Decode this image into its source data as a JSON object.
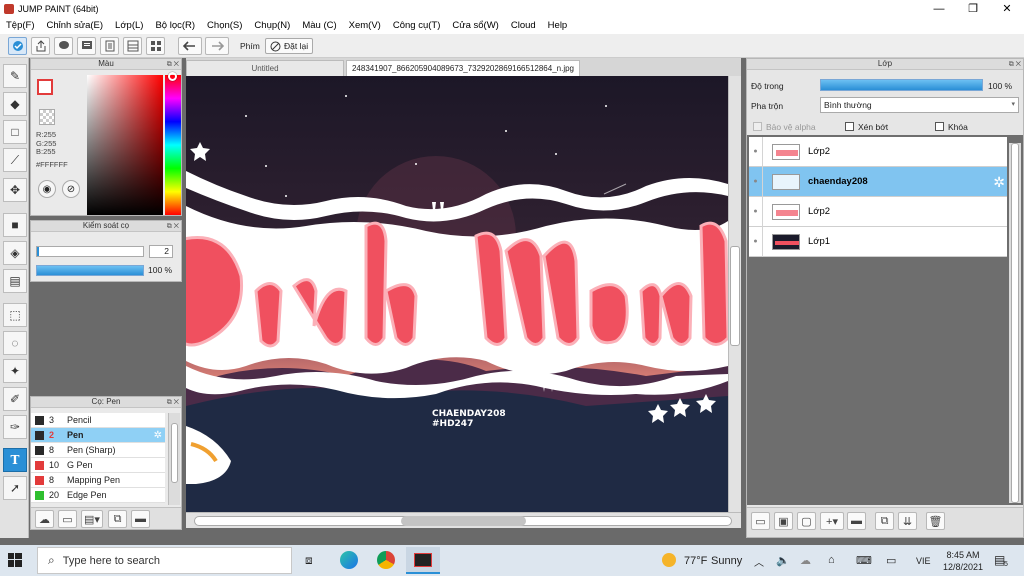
{
  "app": {
    "title": "JUMP PAINT (64bit)",
    "window_buttons": [
      "—",
      "❐",
      "✕"
    ]
  },
  "menu": [
    "Tệp(F)",
    "Chỉnh sửa(E)",
    "Lớp(L)",
    "Bộ lọc(R)",
    "Chọn(S)",
    "Chụp(N)",
    "Màu (C)",
    "Xem(V)",
    "Công cụ(T)",
    "Cửa sổ(W)",
    "Cloud",
    "Help"
  ],
  "toolbar": {
    "shortcut_label": "Phím",
    "reset_label": "Đặt lại"
  },
  "color_panel": {
    "title": "Màu",
    "r": "R:255",
    "g": "G:255",
    "b": "B:255",
    "hex": "#FFFFFF"
  },
  "brush_control": {
    "title": "Kiểm soát cọ",
    "size_value": "2",
    "opacity_value": "100 %"
  },
  "brush_panel": {
    "title": "Cọ: Pen",
    "items": [
      {
        "size": "3",
        "name": "Pencil",
        "color": "#2a2a2a"
      },
      {
        "size": "2",
        "name": "Pen",
        "color": "#2a2a2a"
      },
      {
        "size": "8",
        "name": "Pen (Sharp)",
        "color": "#2a2a2a"
      },
      {
        "size": "10",
        "name": "G Pen",
        "color": "#e23b3b"
      },
      {
        "size": "8",
        "name": "Mapping Pen",
        "color": "#e23b3b"
      },
      {
        "size": "20",
        "name": "Edge Pen",
        "color": "#2fbf2f"
      }
    ]
  },
  "tabs": [
    {
      "label": "Untitled"
    },
    {
      "label": "248341907_866205904089673_7329202869166512864_n.jpg"
    }
  ],
  "artwork": {
    "handwritten_title": "Bình Minh",
    "signature_line1": "CHAENDAY208",
    "signature_line2": "#HD247"
  },
  "layer_panel": {
    "title": "Lớp",
    "opacity_label": "Độ trong",
    "opacity_value": "100 %",
    "blend_label": "Pha trộn",
    "blend_value": "Bình thường",
    "protect_alpha": "Bảo vệ alpha",
    "clip": "Xén bớt",
    "lock": "Khóa",
    "layers": [
      {
        "name": "Lớp2"
      },
      {
        "name": "chaenday208"
      },
      {
        "name": "Lớp2"
      },
      {
        "name": "Lớp1"
      }
    ]
  },
  "taskbar": {
    "search_placeholder": "Type here to search",
    "weather_temp": "77°F",
    "weather_desc": "Sunny",
    "lang": "VIE",
    "time": "8:45 AM",
    "date": "12/8/2021",
    "notification_count": "5"
  },
  "colors": {
    "accent": "#2a8fd6",
    "selection": "#80c4f0",
    "artwork_pink": "#f0505f"
  }
}
